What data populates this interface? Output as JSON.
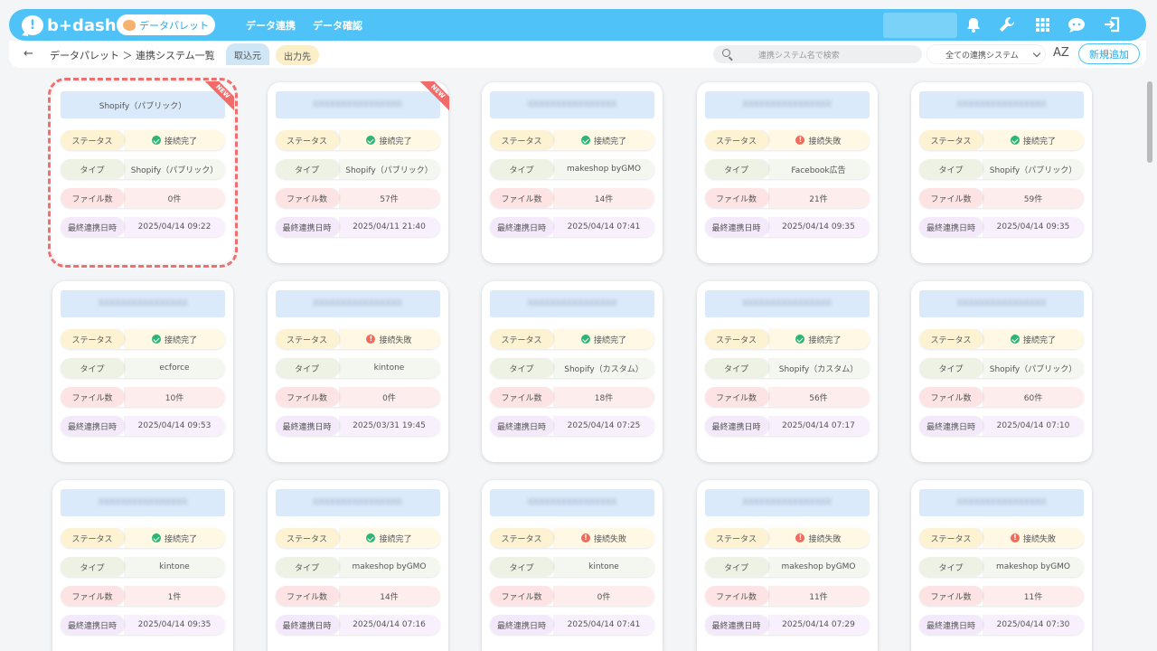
{
  "header": {
    "logo_text": "b+dash",
    "palette_label": "データパレット",
    "nav": [
      "データ連携",
      "データ確認"
    ],
    "icons": [
      "bell-icon",
      "wrench-icon",
      "grid-icon",
      "chat-icon",
      "logout-icon"
    ]
  },
  "subbar": {
    "breadcrumb": "データパレット ＞ 連携システム一覧",
    "tab_import": "取込元",
    "tab_export": "出力先",
    "search_placeholder": "連携システム名で検索",
    "filter_value": "全ての連携システム",
    "sort_label": "AZ",
    "add_button": "新規追加"
  },
  "labels": {
    "status": "ステータス",
    "type": "タイプ",
    "files": "ファイル数",
    "last_sync": "最終連携日時"
  },
  "cards": [
    {
      "title": "Shopify（パブリック）",
      "blurred": false,
      "is_new": true,
      "status": "接続完了",
      "status_ok": true,
      "type": "Shopify（パブリック）",
      "files": "0件",
      "date": "2025/04/14 09:22"
    },
    {
      "title": "XXXXXXXXXXXXXXXX",
      "blurred": true,
      "is_new": true,
      "status": "接続完了",
      "status_ok": true,
      "type": "Shopify（パブリック）",
      "files": "57件",
      "date": "2025/04/11 21:40"
    },
    {
      "title": "XXXXXXXXXXXXXXXX",
      "blurred": true,
      "is_new": false,
      "status": "接続完了",
      "status_ok": true,
      "type": "makeshop byGMO",
      "files": "14件",
      "date": "2025/04/14 07:41"
    },
    {
      "title": "XXXXXXXXXXXXXXXX",
      "blurred": true,
      "is_new": false,
      "status": "接続失敗",
      "status_ok": false,
      "type": "Facebook広告",
      "files": "21件",
      "date": "2025/04/14 09:35"
    },
    {
      "title": "XXXXXXXXXXXXXXXX",
      "blurred": true,
      "is_new": false,
      "status": "接続完了",
      "status_ok": true,
      "type": "Shopify（パブリック）",
      "files": "59件",
      "date": "2025/04/14 09:35"
    },
    {
      "title": "XXXXXXXXXXXXXXXX",
      "blurred": true,
      "is_new": false,
      "status": "接続完了",
      "status_ok": true,
      "type": "ecforce",
      "files": "10件",
      "date": "2025/04/14 09:53"
    },
    {
      "title": "XXXXXXXXXXXXXXXX",
      "blurred": true,
      "is_new": false,
      "status": "接続失敗",
      "status_ok": false,
      "type": "kintone",
      "files": "0件",
      "date": "2025/03/31 19:45"
    },
    {
      "title": "XXXXXXXXXXXXXXXX",
      "blurred": true,
      "is_new": false,
      "status": "接続完了",
      "status_ok": true,
      "type": "Shopify（カスタム）",
      "files": "18件",
      "date": "2025/04/14 07:25"
    },
    {
      "title": "XXXXXXXXXXXXXXXX",
      "blurred": true,
      "is_new": false,
      "status": "接続完了",
      "status_ok": true,
      "type": "Shopify（カスタム）",
      "files": "56件",
      "date": "2025/04/14 07:17"
    },
    {
      "title": "XXXXXXXXXXXXXXXX",
      "blurred": true,
      "is_new": false,
      "status": "接続完了",
      "status_ok": true,
      "type": "Shopify（パブリック）",
      "files": "60件",
      "date": "2025/04/14 07:10"
    },
    {
      "title": "XXXXXXXXXXXXXXXX",
      "blurred": true,
      "is_new": false,
      "status": "接続完了",
      "status_ok": true,
      "type": "kintone",
      "files": "1件",
      "date": "2025/04/14 09:35"
    },
    {
      "title": "XXXXXXXXXXXXXXXX",
      "blurred": true,
      "is_new": false,
      "status": "接続完了",
      "status_ok": true,
      "type": "makeshop byGMO",
      "files": "14件",
      "date": "2025/04/14 07:16"
    },
    {
      "title": "XXXXXXXXXXXXXXXX",
      "blurred": true,
      "is_new": false,
      "status": "接続失敗",
      "status_ok": false,
      "type": "kintone",
      "files": "0件",
      "date": "2025/04/14 07:41"
    },
    {
      "title": "XXXXXXXXXXXXXXXX",
      "blurred": true,
      "is_new": false,
      "status": "接続失敗",
      "status_ok": false,
      "type": "makeshop byGMO",
      "files": "11件",
      "date": "2025/04/14 07:29"
    },
    {
      "title": "XXXXXXXXXXXXXXXX",
      "blurred": true,
      "is_new": false,
      "status": "接続失敗",
      "status_ok": false,
      "type": "makeshop byGMO",
      "files": "11件",
      "date": "2025/04/14 07:30"
    }
  ],
  "new_badge": "NEW",
  "colors": {
    "brand": "#4fc3f7",
    "ok": "#2bb673",
    "error": "#f16b5a",
    "selected_outline": "#ef6f6f"
  }
}
